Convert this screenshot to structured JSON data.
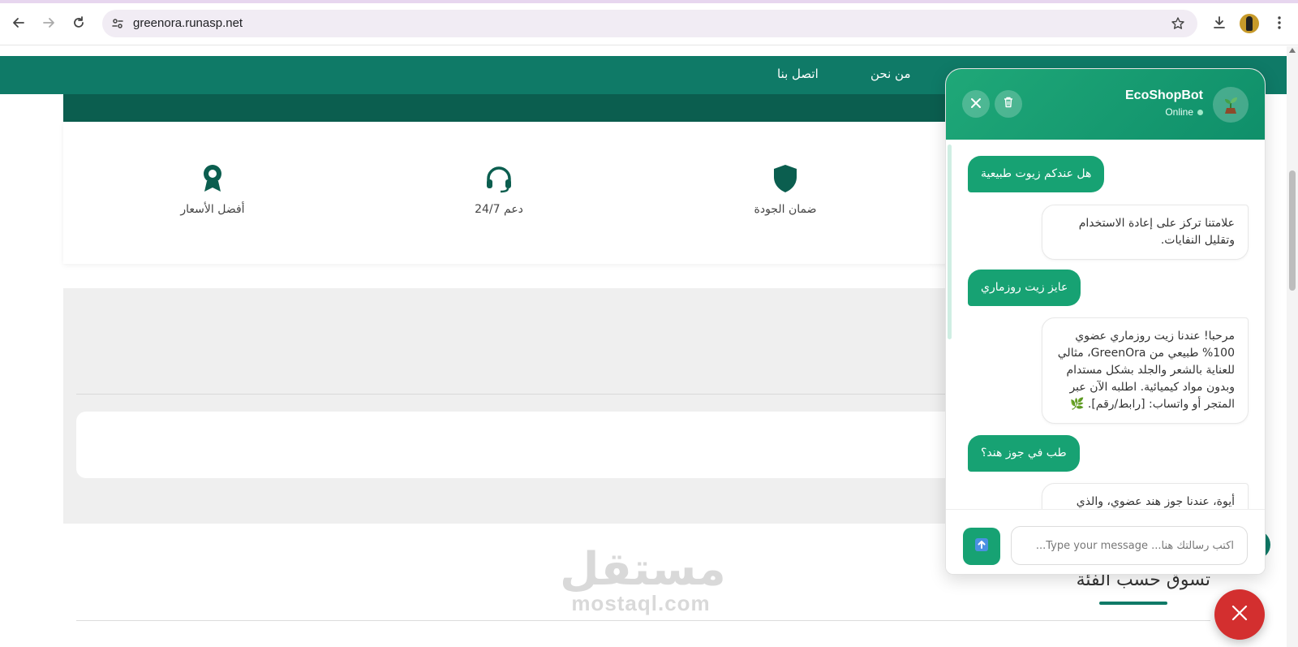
{
  "browser": {
    "url": "greenora.runasp.net"
  },
  "nav": {
    "about": "من نحن",
    "contact": "اتصل بنا"
  },
  "features": [
    {
      "label": "ضمان الجودة",
      "icon": "shield-icon"
    },
    {
      "label": "دعم 24/7",
      "icon": "headset-icon"
    },
    {
      "label": "أفضل الأسعار",
      "icon": "award-ribbon-icon"
    }
  ],
  "section": {
    "category_title": "تسوق حسب الفئة"
  },
  "watermark": {
    "arabic": "مستقل",
    "latin": "mostaql.com"
  },
  "chat": {
    "bot_name": "EcoShopBot",
    "status": "Online",
    "messages": [
      {
        "from": "user",
        "text": "هل عندكم زيوت طبيعية"
      },
      {
        "from": "bot",
        "text": "علامتنا تركز على إعادة الاستخدام وتقليل النفايات."
      },
      {
        "from": "user",
        "text": "عايز زيت روزماري"
      },
      {
        "from": "bot",
        "text": "مرحبا! عندنا زيت روزماري عضوي 100% طبيعي من GreenOra، مثالي للعناية بالشعر والجلد بشكل مستدام وبدون مواد كيميائية. اطلبه الآن عبر المتجر أو واتساب: [رابط/رقم]. 🌿"
      },
      {
        "from": "user",
        "text": "طب في جوز هند؟"
      },
      {
        "from": "bot",
        "text": "أيوة، عندنا جوز هند عضوي، والذي"
      }
    ],
    "input_placeholder": "اكتب رسالتك هنا... Type your message..."
  },
  "colors": {
    "brand_green": "#0f7a67",
    "chat_green": "#17a273",
    "close_red": "#d32f2f"
  }
}
